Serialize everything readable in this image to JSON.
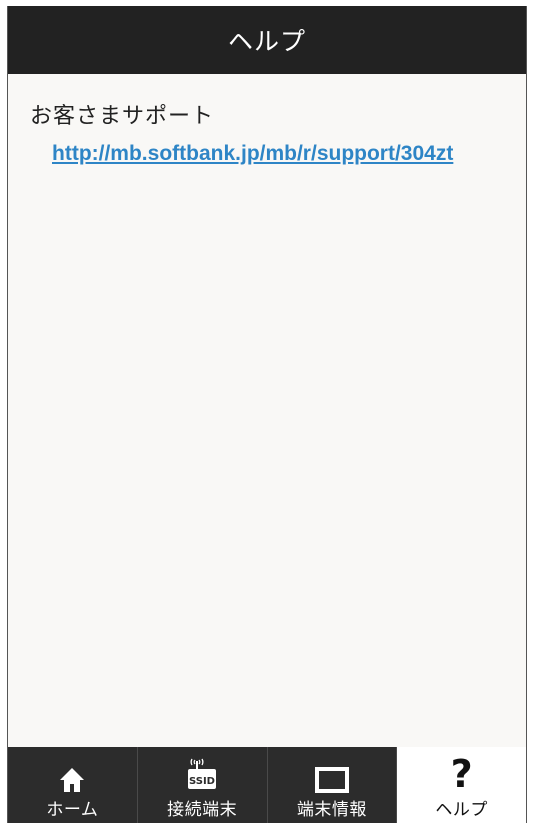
{
  "header": {
    "title": "ヘルプ"
  },
  "content": {
    "support_title": "お客さまサポート",
    "support_url": "http://mb.softbank.jp/mb/r/support/304zt"
  },
  "tabbar": {
    "tabs": [
      {
        "label": "ホーム",
        "icon": "home-icon",
        "active": false
      },
      {
        "label": "接続端末",
        "icon": "wifi-ssid-icon",
        "active": false,
        "icon_text": "SSID"
      },
      {
        "label": "端末情報",
        "icon": "device-icon",
        "active": false
      },
      {
        "label": "ヘルプ",
        "icon": "help-icon",
        "active": true
      }
    ]
  },
  "colors": {
    "header_bg": "#222222",
    "tabbar_bg": "#2c2c2c",
    "link": "#2e85c6",
    "content_bg": "#f9f8f6"
  }
}
